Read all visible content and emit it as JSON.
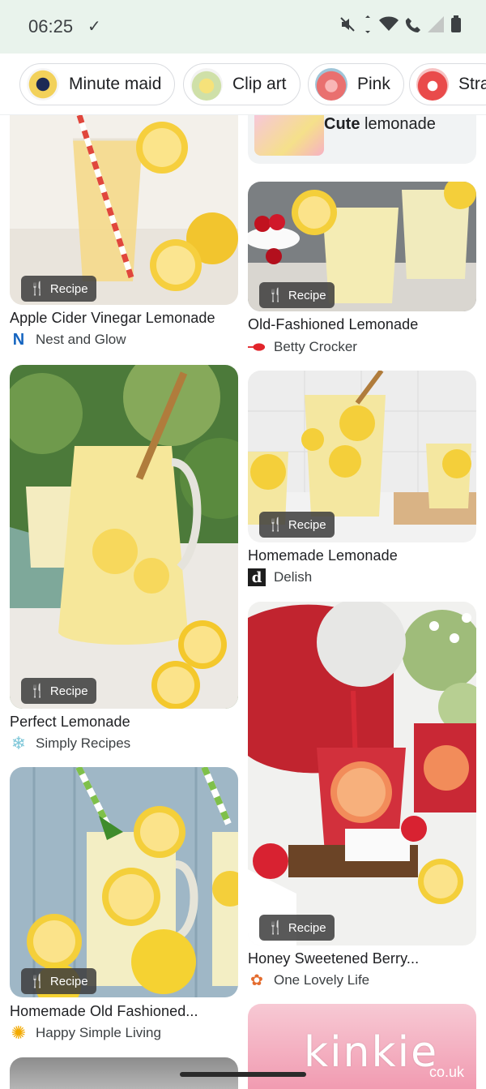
{
  "status_bar": {
    "time": "06:25",
    "check_icon": "✓",
    "icons": [
      "mute-icon",
      "data-icon",
      "wifi-icon",
      "call-icon",
      "signal-icon",
      "battery-icon"
    ]
  },
  "chips": [
    {
      "label": "Minute maid",
      "thumb_color": "#f2d15a"
    },
    {
      "label": "Clip art",
      "thumb_color": "#d7e6b5"
    },
    {
      "label": "Pink",
      "thumb_color": "#f08a8a"
    },
    {
      "label": "Stra",
      "thumb_color": "#e94b4b"
    }
  ],
  "cards": {
    "cute": {
      "title_bold": "Cute",
      "title_rest": " lemonade"
    },
    "acv": {
      "badge": "Recipe",
      "title": "Apple Cider Vinegar Lemonade",
      "source": "Nest and Glow",
      "source_icon": "N"
    },
    "old_fashioned": {
      "badge": "Recipe",
      "title": "Old-Fashioned Lemonade",
      "source": "Betty Crocker"
    },
    "perfect": {
      "badge": "Recipe",
      "title": "Perfect Lemonade",
      "source": "Simply Recipes"
    },
    "homemade": {
      "badge": "Recipe",
      "title": "Homemade Lemonade",
      "source": "Delish",
      "source_icon": "d"
    },
    "honey_berry": {
      "badge": "Recipe",
      "title": "Honey Sweetened Berry...",
      "source": "One Lovely Life"
    },
    "homemade_old": {
      "badge": "Recipe",
      "title": "Homemade Old Fashioned...",
      "source": "Happy Simple Living"
    }
  },
  "watermark": {
    "text": "kinkie",
    "sub": "co.uk"
  },
  "colors": {
    "accent_blue": "#1a73e8",
    "status_bg": "#e9f3ec"
  }
}
